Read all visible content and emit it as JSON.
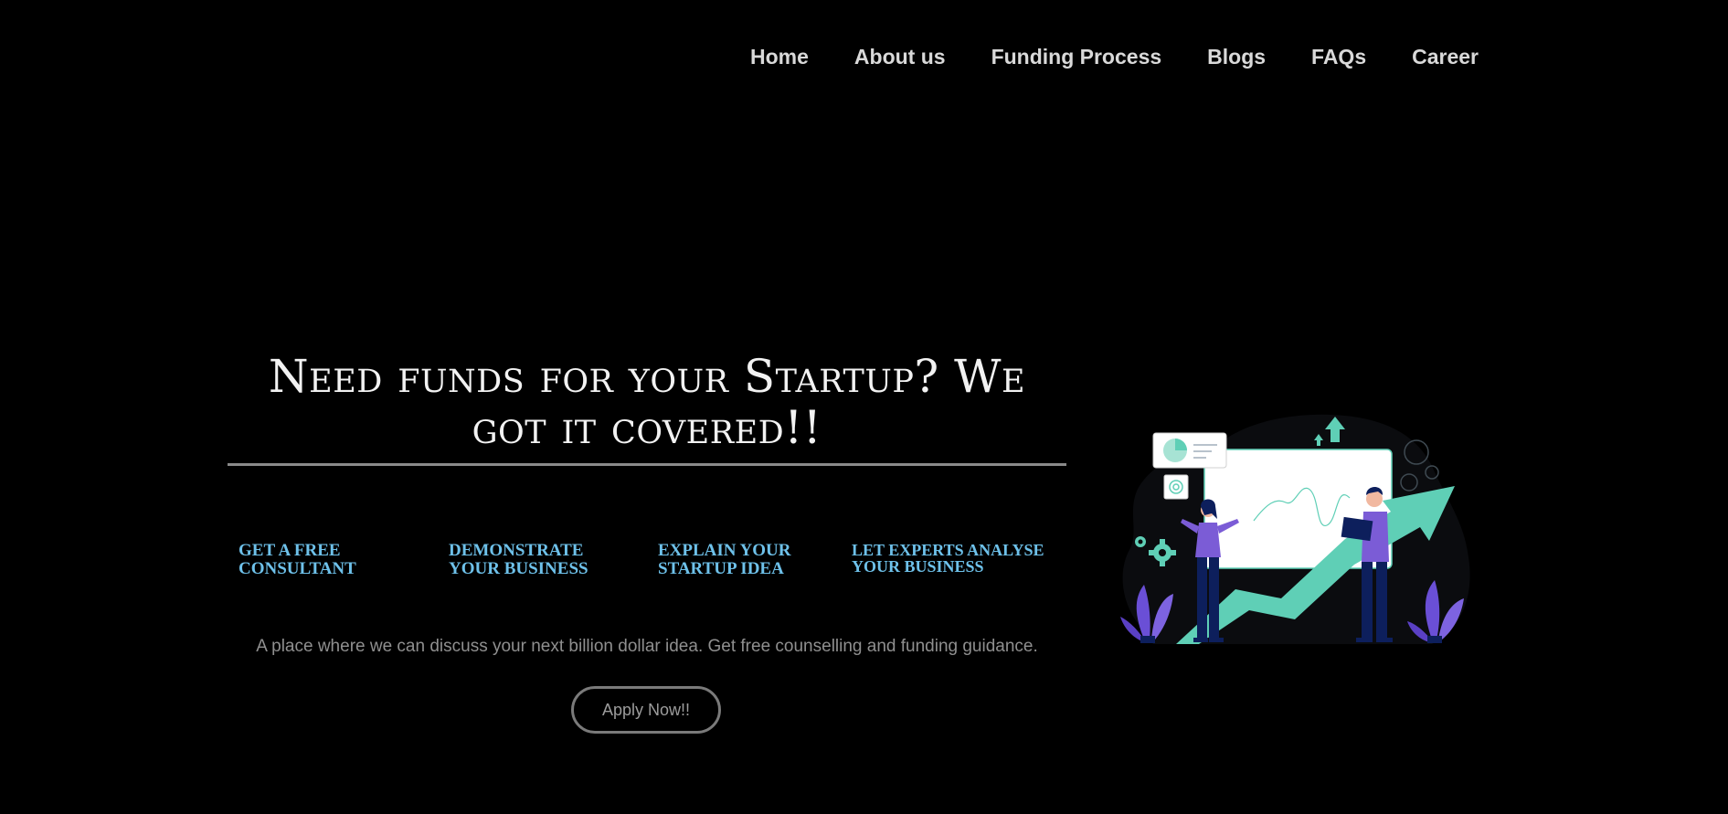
{
  "nav": {
    "items": [
      "Home",
      "About us",
      "Funding Process",
      "Blogs",
      "FAQs",
      "Career"
    ]
  },
  "hero": {
    "headline": "Need funds for your Startup? We got it covered!!",
    "steps": [
      "GET A FREE\nCONSULTANT",
      "DEMONSTRATE\nYOUR BUSINESS",
      "EXPLAIN YOUR\nSTARTUP IDEA",
      "LET EXPERTS ANALYSE\nYOUR BUSINESS"
    ],
    "tagline": "A place where we can discuss your next billion dollar idea. Get free counselling and funding guidance.",
    "apply_label": "Apply Now!!"
  },
  "colors": {
    "background": "#000000",
    "accent_blue": "#6ec1ea",
    "teal": "#5fcfb6",
    "purple": "#6a4fd6",
    "navy": "#0d1f5c"
  },
  "icons": [
    "pie-chart-icon",
    "gear-icon",
    "growth-arrow-icon",
    "plant-icon"
  ]
}
